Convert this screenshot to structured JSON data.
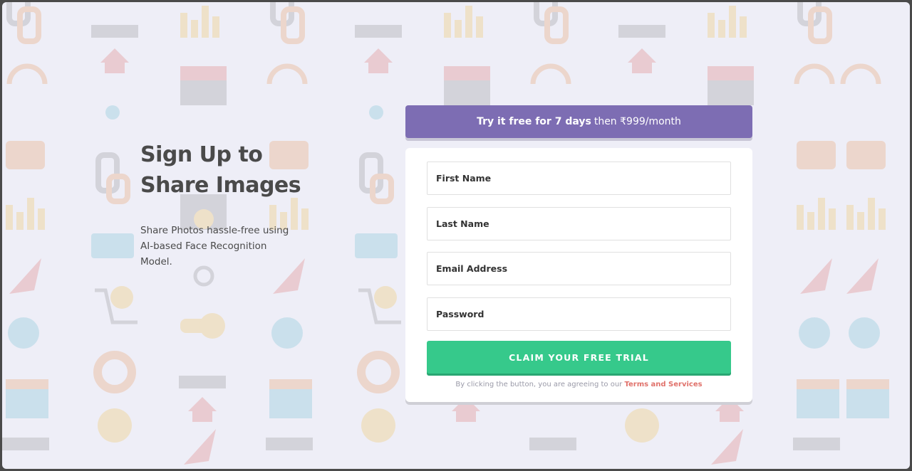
{
  "hero": {
    "title_line1": "Sign Up to",
    "title_line2": "Share Images",
    "subtitle": "Share Photos hassle-free using AI-based Face Recognition Model."
  },
  "banner": {
    "bold": "Try it free for 7 days",
    "rest": "then ₹999/month",
    "color": "#7d6db3"
  },
  "form": {
    "first_name_placeholder": "First Name",
    "last_name_placeholder": "Last Name",
    "email_placeholder": "Email Address",
    "password_placeholder": "Password",
    "submit_label": "CLAIM YOUR FREE TRIAL",
    "submit_color": "#36c98b",
    "terms_prefix": "By clicking the button, you are agreeing to our",
    "terms_link": "Terms and Services"
  },
  "background_icons": [
    "chain-link-icon",
    "bar-chart-icon",
    "browser-window-icon",
    "home-icon",
    "headset-icon",
    "toolbox-icon",
    "network-icon",
    "rocket-icon",
    "shopping-cart-icon",
    "key-icon",
    "gear-icon",
    "lifebuoy-icon",
    "calendar-icon",
    "lightbulb-icon",
    "thumbs-up-icon",
    "chat-icon"
  ]
}
